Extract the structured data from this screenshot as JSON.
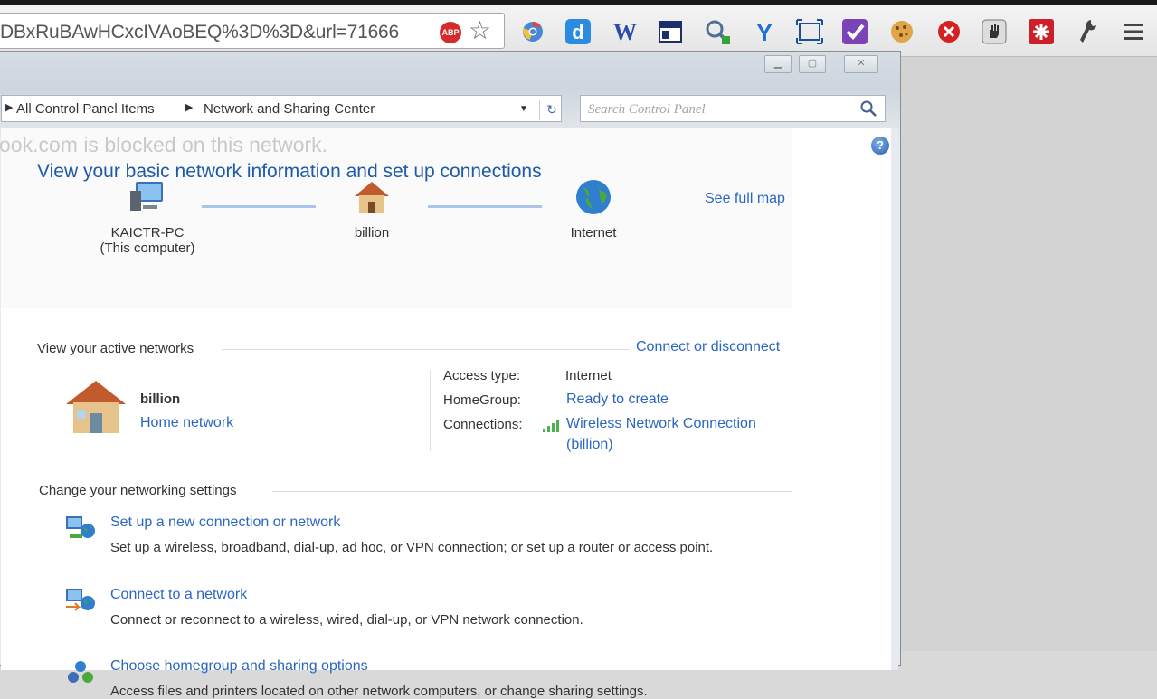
{
  "browser": {
    "url": "DBxRuBAwHCxcIVAoBEQ%3D%3D&url=71666",
    "abp_badge": "ABP",
    "extensions": [
      "chrome-icon",
      "d-icon",
      "w-icon",
      "window-icon",
      "key-icon",
      "y-icon",
      "capture-icon",
      "check-icon",
      "cookie-icon",
      "stop-icon",
      "hand-icon",
      "plus-icon",
      "wrench-icon",
      "menu-icon"
    ],
    "extension_W": "W",
    "extension_d": "d",
    "extension_Y": "Y"
  },
  "window": {
    "breadcrumb": [
      "All Control Panel Items",
      "Network and Sharing Center"
    ],
    "search_placeholder": "Search Control Panel",
    "blocked_notice": "ook.com is blocked on this network.",
    "help": "?"
  },
  "main": {
    "title": "View your basic network information and set up connections",
    "see_full_map": "See full map",
    "map": {
      "computer_name": "KAICTR-PC",
      "computer_sub": "(This computer)",
      "router": "billion",
      "internet": "Internet"
    },
    "active": {
      "heading": "View your active networks",
      "connect_link": "Connect or disconnect",
      "network_name": "billion",
      "network_type": "Home network",
      "access_label": "Access type:",
      "access_value": "Internet",
      "homegroup_label": "HomeGroup:",
      "homegroup_value": "Ready to create",
      "connections_label": "Connections:",
      "connections_value_1": "Wireless Network Connection",
      "connections_value_2": "(billion)"
    },
    "settings": {
      "heading": "Change your networking settings",
      "items": [
        {
          "title": "Set up a new connection or network",
          "desc": "Set up a wireless, broadband, dial-up, ad hoc, or VPN connection; or set up a router or access point."
        },
        {
          "title": "Connect to a network",
          "desc": "Connect or reconnect to a wireless, wired, dial-up, or VPN network connection."
        },
        {
          "title": "Choose homegroup and sharing options",
          "desc": "Access files and printers located on other network computers, or change sharing settings."
        }
      ]
    }
  },
  "colors": {
    "link": "#2a66c0",
    "title": "#1e5aa8"
  }
}
